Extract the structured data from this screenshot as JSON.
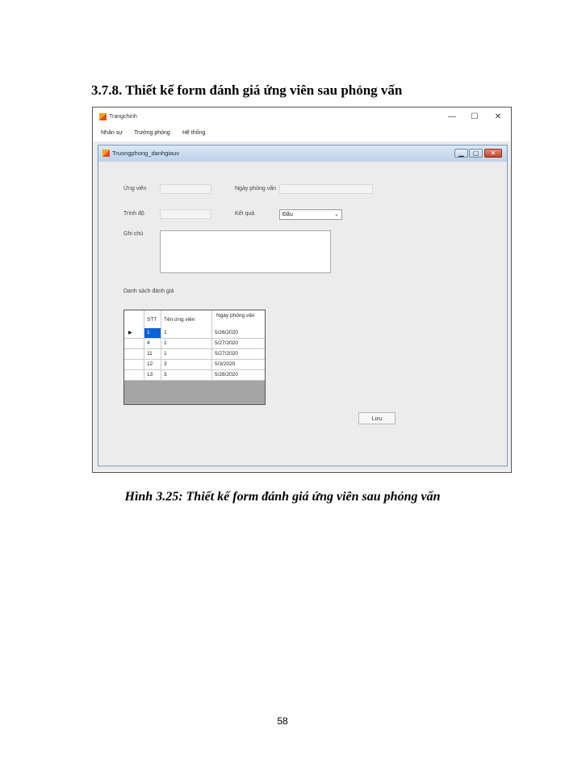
{
  "document": {
    "heading": "3.7.8. Thiết kế form đánh giá ứng viên sau phỏng vấn",
    "caption": "Hình 3.25: Thiết kế form đánh giá ứng viên sau phỏng vấn",
    "page_number": "58"
  },
  "outer_window": {
    "title": "Trangchinh",
    "controls": {
      "minimize": "—",
      "maximize": "☐",
      "close": "✕"
    },
    "menu": [
      "Nhân sự",
      "Trưởng phòng",
      "Hệ thống"
    ]
  },
  "inner_window": {
    "title": "Truongphong_danhgiauv",
    "controls": {
      "minimize": "▁",
      "maximize": "▢",
      "close": "✕"
    }
  },
  "form": {
    "ung_vien_label": "Ứng viên",
    "ngay_phong_van_label": "Ngày phỏng vấn",
    "trinh_do_label": "Trình độ",
    "ket_qua_label": "Kết quả",
    "ket_qua_value": "Đậu",
    "ghi_chu_label": "Ghi chú",
    "list_label": "Danh sách đánh giá",
    "save_label": "Lưu"
  },
  "grid": {
    "columns": [
      "STT",
      "Tên ứng viên",
      "Ngày phỏng vấn"
    ],
    "rows": [
      [
        "1",
        "1",
        "5/26/2020"
      ],
      [
        "4",
        "1",
        "5/27/2020"
      ],
      [
        "11",
        "1",
        "5/27/2020"
      ],
      [
        "12",
        "3",
        "5/3/2020"
      ],
      [
        "13",
        "3",
        "5/28/2020"
      ]
    ],
    "current_row_marker": "▶"
  }
}
